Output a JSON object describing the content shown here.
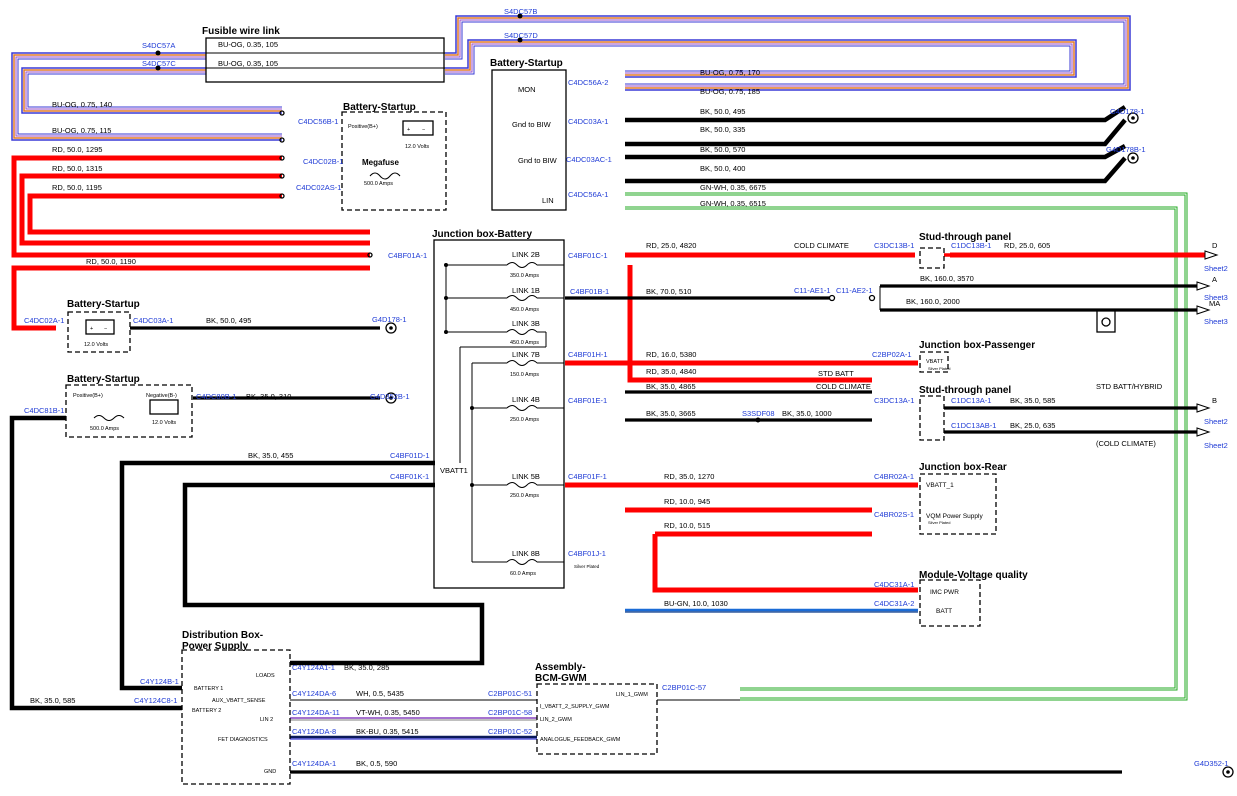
{
  "blocks": {
    "fusible_wire_link": "Fusible wire link",
    "battery_startup_main": "Battery-Startup",
    "battery_startup_megafuse": "Battery-Startup",
    "megafuse": "Megafuse",
    "megafuse_rating": "500.0 Amps",
    "positive_b": "Positive(B+)",
    "volts_12_a": "12.0 Volts",
    "junction_box_battery": "Junction box-Battery",
    "battery_startup_left1": "Battery-Startup",
    "volts_12_b": "12.0 Volts",
    "battery_startup_left2": "Battery-Startup",
    "positive_b2": "Positive(B+)",
    "negative_b": "Negative(B-)",
    "amps_500": "500.0 Amps",
    "volts_12_c": "12.0 Volts",
    "stud_through_panel_1": "Stud-through panel",
    "junction_box_passenger": "Junction box-Passenger",
    "vbatt": "VBATT",
    "silver_plated_1": "Silver Plated",
    "stud_through_panel_2": "Stud-through panel",
    "junction_box_rear": "Junction box-Rear",
    "vbatt_1": "VBATT_1",
    "vqm_power_supply": "VQM Power Supply",
    "silver_plated_2": "Silver Plated",
    "module_voltage_quality": "Module-Voltage quality",
    "imc_pwr": "IMC PWR",
    "batt": "BATT",
    "distribution_box_1": "Distribution Box-",
    "distribution_box_2": "Power Supply",
    "assembly_bcm_1": "Assembly-",
    "assembly_bcm_2": "BCM-GWM",
    "mon": "MON",
    "gnd_to_biw_1": "Gnd to BIW",
    "gnd_to_biw_2": "Gnd to BIW",
    "lin": "LIN",
    "vbatt1": "VBATT1",
    "silver_plated_3": "Silver Plated"
  },
  "fuses": {
    "link2b": "LINK 2B",
    "link2b_amps": "350.0 Amps",
    "link1b": "LINK 1B",
    "link1b_amps": "450.0 Amps",
    "link3b": "LINK 3B",
    "link3b_amps": "450.0 Amps",
    "link7b": "LINK 7B",
    "link7b_amps": "150.0 Amps",
    "link4b": "LINK 4B",
    "link4b_amps": "250.0 Amps",
    "link5b": "LINK 5B",
    "link5b_amps": "250.0 Amps",
    "link8b": "LINK 8B",
    "link8b_amps": "60.0 Amps"
  },
  "connectors": {
    "s4dc57b": "S4DC57B",
    "s4dc57d": "S4DC57D",
    "s4dc57a": "S4DC57A",
    "s4dc57c": "S4DC57C",
    "c4dc56a2": "C4DC56A-2",
    "c4dc56b1": "C4DC56B-1",
    "c4dc03a1": "C4DC03A-1",
    "c4dc02b1": "C4DC02B-1",
    "c4dc03ac1": "C4DC03AC-1",
    "c4dc02as1": "C4DC02AS-1",
    "c4dc56a1": "C4DC56A-1",
    "g4d178_1": "G4D178-1",
    "g4d178b_1": "G4D178B-1",
    "c4bf01a1": "C4BF01A-1",
    "c4bf01c1": "C4BF01C-1",
    "c3dc13b1": "C3DC13B-1",
    "c1dc13b1": "C1DC13B-1",
    "c4bf01b1": "C4BF01B-1",
    "c11ae1_1": "C11-AE1-1",
    "c11ae2_1": "C11-AE2-1",
    "c4dc02a1": "C4DC02A-1",
    "c4dc03a1b": "C4DC03A-1",
    "g4d178_1b": "G4D178-1",
    "c4bf01h1": "C4BF01H-1",
    "c2bp02a1": "C2BP02A-1",
    "c4bf01e1": "C4BF01E-1",
    "c3dc13a1": "C3DC13A-1",
    "c1dc13a1": "C1DC13A-1",
    "c1dc13ab1": "C1DC13AB-1",
    "s3sdf08": "S3SDF08",
    "c4dc81b1": "C4DC81B-1",
    "c4dc80b1": "C4DC80B-1",
    "g4d352b1": "G4D352B-1",
    "c4bf01d1": "C4BF01D-1",
    "c4bf01k1": "C4BF01K-1",
    "c4bf01f1": "C4BF01F-1",
    "c4br02a1": "C4BR02A-1",
    "c4br02s1": "C4BR02S-1",
    "c4bf01j1": "C4BF01J-1",
    "c4dc31a1": "C4DC31A-1",
    "c4dc31a2": "C4DC31A-2",
    "c4y124a1_1": "C4Y124A1-1",
    "c4y124b1": "C4Y124B-1",
    "c4y124c8_1": "C4Y124C8-1",
    "c4y124da6": "C4Y124DA-6",
    "c2bp01c51": "C2BP01C-51",
    "c4y124da11": "C4Y124DA-11",
    "c2bp01c58": "C2BP01C-58",
    "c4y124da8": "C4Y124DA-8",
    "c2bp01c52": "C2BP01C-52",
    "c2bp01c57": "C2BP01C-57",
    "c4y124da1": "C4Y124DA-1",
    "g4d352_1": "G4D352-1"
  },
  "wires": {
    "fwl_1": "BU-OG,  0.35,  105",
    "fwl_2": "BU-OG,  0.35,  105",
    "w170": "BU-OG,  0.75,  170",
    "w185": "BU-OG,  0.75,  185",
    "w140": "BU-OG,  0.75,  140",
    "w115": "BU-OG,  0.75,  115",
    "w495": "BK,  50.0,  495",
    "w335": "BK,  50.0,  335",
    "w570": "BK,  50.0,  570",
    "w400": "BK,  50.0,  400",
    "w1295": "RD,  50.0,  1295",
    "w1315": "RD,  50.0,  1315",
    "w1195": "RD,  50.0,  1195",
    "w6675": "GN-WH,  0.35,  6675",
    "w6515": "GN-WH,  0.35,  6515",
    "w1190": "RD,  50.0,  1190",
    "w4820": "RD,  25.0,  4820",
    "cold_climate_1": "COLD CLIMATE",
    "w605": "RD,  25.0,  605",
    "w3570": "BK,  160.0,  3570",
    "w510": "BK,  70.0,  510",
    "w2000": "BK,  160.0,  2000",
    "w495b": "BK,  50.0,  495",
    "w5380": "RD,  16.0,  5380",
    "w4840": "RD,  35.0,  4840",
    "std_batt": "STD BATT",
    "w4865": "BK,  35.0,  4865",
    "cold_climate_2": "COLD CLIMATE",
    "w585": "BK,  35.0,  585",
    "w3665": "BK,  35.0,  3665",
    "w1000": "BK,  35.0,  1000",
    "w635": "BK,  25.0,  635",
    "w310": "BK,  35.0,  310",
    "w455": "BK,  35.0,  455",
    "w1270": "RD,  35.0,  1270",
    "w945": "RD,  10.0,  945",
    "w515": "RD,  10.0,  515",
    "w1030": "BU-GN,  10.0,  1030",
    "w285": "BK,  35.0,  285",
    "w585b": "BK,  35.0,  585",
    "w5435": "WH,  0.5,  5435",
    "w5450": "VT-WH,  0.35,  5450",
    "w5415": "BK-BU,  0.35,  5415",
    "w590": "BK,  0.5,  590",
    "std_batt_hybrid": "STD BATT/HYBRID",
    "cold_climate_paren": "(COLD CLIMATE)"
  },
  "offpage": {
    "d": "D",
    "sheet2_d": "Sheet2",
    "a": "A",
    "sheet3_a": "Sheet3",
    "ma": "MA",
    "sheet3_ma": "Sheet3",
    "b": "B",
    "sheet2_b": "Sheet2",
    "sheet2_c": "Sheet2"
  },
  "pins": {
    "loads": "LOADS",
    "battery1": "BATTERY 1",
    "aux_vbatt_sense": "AUX_VBATT_SENSE",
    "battery2": "BATTERY 2",
    "lin2": "LIN 2",
    "fet_diag": "FET DIAGNOSTICS",
    "gnd": "GND",
    "lin1_gwm": "LIN_1_GWM",
    "i_vbatt2": "I_VBATT_2_SUPPLY_GWM",
    "lin2_gwm": "LIN_2_GWM",
    "analogue": "ANALOGUE_FEEDBACK_GWM"
  },
  "colors": {
    "power": "#ff0000",
    "ground": "#000000",
    "signal_blue": "#3a3ad6",
    "signal_orange": "#e07a2a",
    "lin_green": "#22aa22",
    "connector_text": "#1f3bd6"
  }
}
